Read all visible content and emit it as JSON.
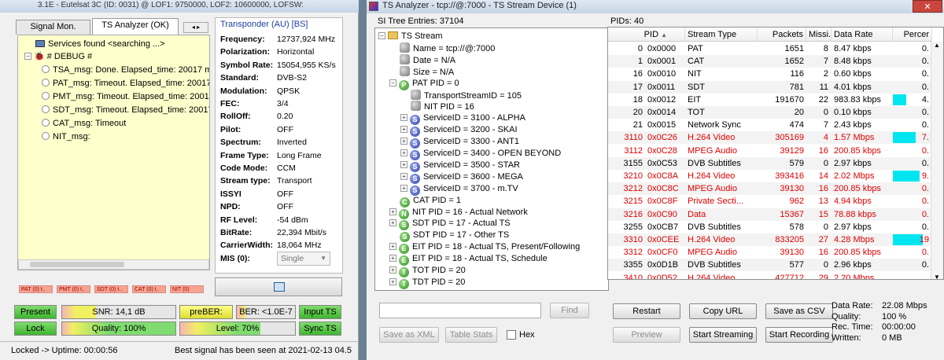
{
  "left_window": {
    "title": "3.1E - Eutelsat 3C (ID: 0031) @ LOF1: 9750000, LOF2: 10600000, LOFSW:",
    "tabs": [
      "Signal Mon.",
      "TS Analyzer (OK)"
    ],
    "tree": {
      "services": "Services found <searching ...>",
      "debug": "# DEBUG #",
      "items": [
        "TSA_msg: Done. Elapsed_time: 20017 ms",
        "PAT_msg: Timeout. Elapsed_time: 20017 ms",
        "PMT_msg: Timeout. Elapsed_time: 20017",
        "SDT_msg: Timeout. Elapsed_time: 20017",
        "CAT_msg: Timeout",
        "NIT_msg:"
      ]
    },
    "transponder": {
      "header": "Transponder (AU) [BS]",
      "rows": [
        {
          "label": "Frequency:",
          "value": "12737,924 MHz"
        },
        {
          "label": "Polarization:",
          "value": "Horizontal"
        },
        {
          "label": "Symbol Rate:",
          "value": "15054,955 KS/s"
        },
        {
          "label": "Standard:",
          "value": "DVB-S2"
        },
        {
          "label": "Modulation:",
          "value": "QPSK"
        },
        {
          "label": "FEC:",
          "value": "3/4"
        },
        {
          "label": "RollOff:",
          "value": "0.20"
        },
        {
          "label": "Pilot:",
          "value": "OFF"
        },
        {
          "label": "Spectrum:",
          "value": "Inverted"
        },
        {
          "label": "Frame Type:",
          "value": "Long Frame"
        },
        {
          "label": "Code Mode:",
          "value": "CCM"
        },
        {
          "label": "Stream type:",
          "value": "Transport"
        },
        {
          "label": "ISSYI",
          "value": "OFF"
        },
        {
          "label": "NPD:",
          "value": "OFF"
        },
        {
          "label": "RF Level:",
          "value": "-54 dBm"
        },
        {
          "label": "BitRate:",
          "value": "22,394 Mbit/s"
        },
        {
          "label": "CarrierWidth:",
          "value": "18,064 MHz"
        }
      ],
      "mis_label": "MIS (0):",
      "mis_value": "Single"
    },
    "mini_tags": [
      "PAT (0) t..",
      "PMT (0) t..",
      "SDT (0) t..",
      "CAT (0) t..",
      "NIT (0)"
    ],
    "signal": {
      "present": "Present",
      "snr": "SNR: 14,1 dB",
      "preber": "preBER: <1....",
      "ber": "BER: <1.0E-7",
      "input_ts": "Input TS",
      "lock": "Lock",
      "quality": "Quality: 100%",
      "level": "Level: 70%",
      "sync_ts": "Sync TS"
    },
    "status": {
      "left": "Locked -> Uptime: 00:00:56",
      "right": "Best signal has been seen at 2021-02-13 04.5"
    }
  },
  "right_window": {
    "title": "TS Analyzer - tcp://@:7000 - TS Stream Device (1)",
    "close": "✕",
    "si_header": "SI Tree Entries: 37104",
    "pids_header": "PIDs: 40",
    "tree": [
      {
        "lvl": 0,
        "exp": "−",
        "icon": "folder",
        "text": "TS Stream"
      },
      {
        "lvl": 1,
        "exp": "",
        "icon": "r",
        "text": "Name = tcp://@:7000"
      },
      {
        "lvl": 1,
        "exp": "",
        "icon": "r",
        "text": "Date = N/A"
      },
      {
        "lvl": 1,
        "exp": "",
        "icon": "r",
        "text": "Size = N/A"
      },
      {
        "lvl": 1,
        "exp": "−",
        "icon": "g",
        "ch": "P",
        "text": "PAT PID = 0"
      },
      {
        "lvl": 2,
        "exp": "",
        "icon": "r",
        "text": "TransportStreamID = 105"
      },
      {
        "lvl": 2,
        "exp": "",
        "icon": "r",
        "text": "NIT PID = 16"
      },
      {
        "lvl": 2,
        "exp": "+",
        "icon": "s",
        "ch": "S",
        "text": "ServiceID = 3100 - ALPHA"
      },
      {
        "lvl": 2,
        "exp": "+",
        "icon": "s",
        "ch": "S",
        "text": "ServiceID = 3200 - SKAI"
      },
      {
        "lvl": 2,
        "exp": "+",
        "icon": "s",
        "ch": "S",
        "text": "ServiceID = 3300 - ANT1"
      },
      {
        "lvl": 2,
        "exp": "+",
        "icon": "s",
        "ch": "S",
        "text": "ServiceID = 3400 - OPEN BEYOND"
      },
      {
        "lvl": 2,
        "exp": "+",
        "icon": "s",
        "ch": "S",
        "text": "ServiceID = 3500 - STAR"
      },
      {
        "lvl": 2,
        "exp": "+",
        "icon": "s",
        "ch": "S",
        "text": "ServiceID = 3600 - MEGA"
      },
      {
        "lvl": 2,
        "exp": "+",
        "icon": "s",
        "ch": "S",
        "text": "ServiceID = 3700 - m.TV"
      },
      {
        "lvl": 1,
        "exp": "",
        "icon": "g",
        "ch": "C",
        "text": "CAT PID = 1"
      },
      {
        "lvl": 1,
        "exp": "+",
        "icon": "g",
        "ch": "N",
        "text": "NIT PID = 16 - Actual Network"
      },
      {
        "lvl": 1,
        "exp": "+",
        "icon": "g",
        "ch": "S",
        "text": "SDT PID = 17 - Actual TS"
      },
      {
        "lvl": 1,
        "exp": "",
        "icon": "g",
        "ch": "S",
        "text": "SDT PID = 17 - Other TS"
      },
      {
        "lvl": 1,
        "exp": "+",
        "icon": "g",
        "ch": "E",
        "text": "EIT PID = 18 - Actual TS, Present/Following"
      },
      {
        "lvl": 1,
        "exp": "+",
        "icon": "g",
        "ch": "E",
        "text": "EIT PID = 18 - Actual TS, Schedule"
      },
      {
        "lvl": 1,
        "exp": "+",
        "icon": "g",
        "ch": "T",
        "text": "TOT PID = 20"
      },
      {
        "lvl": 1,
        "exp": "+",
        "icon": "g",
        "ch": "T",
        "text": "TDT PID = 20"
      }
    ],
    "columns": [
      "PID",
      "Stream Type",
      "Packets",
      "Missi...",
      "Data Rate",
      "Percer"
    ],
    "rows": [
      {
        "pid": "0",
        "hex": "0x0000",
        "type": "PAT",
        "packets": "1651",
        "miss": "8",
        "rate": "8.47 kbps",
        "pct": "0.",
        "bar": 0,
        "red": false
      },
      {
        "pid": "1",
        "hex": "0x0001",
        "type": "CAT",
        "packets": "1652",
        "miss": "7",
        "rate": "8.48 kbps",
        "pct": "0.",
        "bar": 0,
        "red": false
      },
      {
        "pid": "16",
        "hex": "0x0010",
        "type": "NIT",
        "packets": "116",
        "miss": "2",
        "rate": "0.60 kbps",
        "pct": "0.",
        "bar": 0,
        "red": false
      },
      {
        "pid": "17",
        "hex": "0x0011",
        "type": "SDT",
        "packets": "781",
        "miss": "11",
        "rate": "4.01 kbps",
        "pct": "0.",
        "bar": 0,
        "red": false
      },
      {
        "pid": "18",
        "hex": "0x0012",
        "type": "EIT",
        "packets": "191670",
        "miss": "22",
        "rate": "983.83 kbps",
        "pct": "4.",
        "bar": 0.45,
        "red": false
      },
      {
        "pid": "20",
        "hex": "0x0014",
        "type": "TOT",
        "packets": "20",
        "miss": "0",
        "rate": "0.10 kbps",
        "pct": "0.",
        "bar": 0,
        "red": false
      },
      {
        "pid": "21",
        "hex": "0x0015",
        "type": "Network Sync",
        "packets": "474",
        "miss": "7",
        "rate": "2.43 kbps",
        "pct": "0.",
        "bar": 0,
        "red": false
      },
      {
        "pid": "3110",
        "hex": "0x0C26",
        "type": "H.264 Video",
        "packets": "305169",
        "miss": "4",
        "rate": "1.57 Mbps",
        "pct": "7.",
        "bar": 0.75,
        "red": true
      },
      {
        "pid": "3112",
        "hex": "0x0C28",
        "type": "MPEG Audio",
        "packets": "39129",
        "miss": "16",
        "rate": "200.85 kbps",
        "pct": "0.",
        "bar": 0,
        "red": true
      },
      {
        "pid": "3155",
        "hex": "0x0C53",
        "type": "DVB Subtitles",
        "packets": "579",
        "miss": "0",
        "rate": "2.97 kbps",
        "pct": "0.",
        "bar": 0,
        "red": false
      },
      {
        "pid": "3210",
        "hex": "0x0C8A",
        "type": "H.264 Video",
        "packets": "393416",
        "miss": "14",
        "rate": "2.02 Mbps",
        "pct": "9.",
        "bar": 0.9,
        "red": true
      },
      {
        "pid": "3212",
        "hex": "0x0C8C",
        "type": "MPEG Audio",
        "packets": "39130",
        "miss": "16",
        "rate": "200.85 kbps",
        "pct": "0.",
        "bar": 0,
        "red": true
      },
      {
        "pid": "3215",
        "hex": "0x0C8F",
        "type": "Private Secti...",
        "packets": "962",
        "miss": "13",
        "rate": "4.94 kbps",
        "pct": "0.",
        "bar": 0,
        "red": true
      },
      {
        "pid": "3216",
        "hex": "0x0C90",
        "type": "Data",
        "packets": "15367",
        "miss": "15",
        "rate": "78.88 kbps",
        "pct": "0.",
        "bar": 0,
        "red": true
      },
      {
        "pid": "3255",
        "hex": "0x0CB7",
        "type": "DVB Subtitles",
        "packets": "578",
        "miss": "0",
        "rate": "2.97 kbps",
        "pct": "0.",
        "bar": 0,
        "red": false
      },
      {
        "pid": "3310",
        "hex": "0x0CEE",
        "type": "H.264 Video",
        "packets": "833205",
        "miss": "27",
        "rate": "4.28 Mbps",
        "pct": "19",
        "bar": 1,
        "red": true
      },
      {
        "pid": "3312",
        "hex": "0x0CF0",
        "type": "MPEG Audio",
        "packets": "39130",
        "miss": "16",
        "rate": "200.85 kbps",
        "pct": "0.",
        "bar": 0,
        "red": true
      },
      {
        "pid": "3355",
        "hex": "0x0D1B",
        "type": "DVB Subtitles",
        "packets": "577",
        "miss": "0",
        "rate": "2.96 kbps",
        "pct": "0.",
        "bar": 0,
        "red": false
      },
      {
        "pid": "3410",
        "hex": "0x0D52",
        "type": "H.264 Video",
        "packets": "427712",
        "miss": "29",
        "rate": "2.20 Mbps",
        "pct": "",
        "bar": 0,
        "red": true
      }
    ],
    "find_placeholder": "",
    "buttons": {
      "find": "Find",
      "save_xml": "Save as XML",
      "table_stats": "Table Stats",
      "hex": "Hex",
      "restart": "Restart",
      "copy_url": "Copy URL",
      "save_csv": "Save as CSV",
      "preview": "Preview",
      "start_streaming": "Start Streaming",
      "start_recording": "Start Recording"
    },
    "stats": [
      {
        "label": "Data Rate:",
        "value": "22.08 Mbps"
      },
      {
        "label": "Quality:",
        "value": "100 %"
      },
      {
        "label": "Rec. Time:",
        "value": "00:00:00"
      },
      {
        "label": "Written:",
        "value": "0 MB"
      }
    ]
  }
}
